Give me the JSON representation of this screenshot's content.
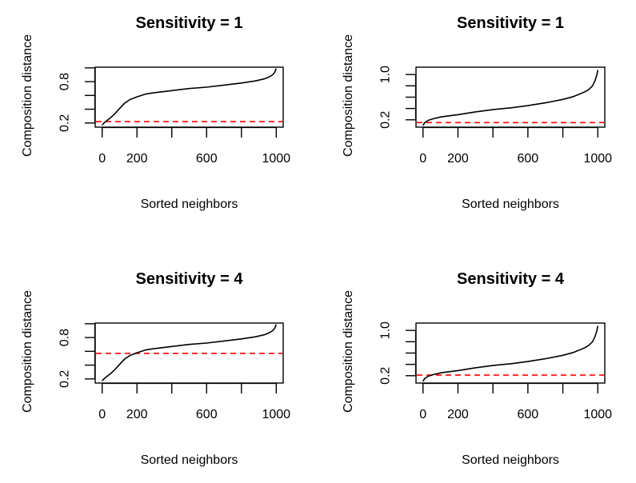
{
  "chart_data": [
    {
      "type": "line",
      "panel": "top-left",
      "title": "Sensitivity =  1",
      "xlabel": "Sorted neighbors",
      "ylabel": "Composition distance",
      "xlim": [
        -40,
        1040
      ],
      "ylim": [
        0.14,
        1.01
      ],
      "xticks": [
        0,
        200,
        400,
        600,
        800,
        1000
      ],
      "xtick_labels": [
        "0",
        "200",
        "",
        "600",
        "",
        "1000"
      ],
      "yticks": [
        0.2,
        0.4,
        0.6,
        0.8,
        1.0
      ],
      "ytick_labels": [
        "0.2",
        "",
        "",
        "0.8",
        ""
      ],
      "grid": false,
      "series": [
        {
          "name": "composition-distance",
          "color": "#000000",
          "x": [
            0,
            10,
            25,
            50,
            75,
            100,
            130,
            160,
            200,
            250,
            300,
            400,
            500,
            600,
            700,
            800,
            880,
            930,
            960,
            980,
            990,
            995,
            1000
          ],
          "y": [
            0.17,
            0.2,
            0.23,
            0.28,
            0.34,
            0.41,
            0.49,
            0.54,
            0.58,
            0.62,
            0.64,
            0.67,
            0.7,
            0.72,
            0.75,
            0.78,
            0.81,
            0.84,
            0.87,
            0.9,
            0.93,
            0.96,
            0.99
          ]
        }
      ],
      "threshold": {
        "value": 0.22,
        "color": "#ff0000",
        "style": "dashed"
      }
    },
    {
      "type": "line",
      "panel": "top-right",
      "title": "Sensitivity =  1",
      "xlabel": "Sorted neighbors",
      "ylabel": "Composition distance",
      "xlim": [
        -40,
        1040
      ],
      "ylim": [
        0.07,
        1.13
      ],
      "xticks": [
        0,
        200,
        400,
        600,
        800,
        1000
      ],
      "xtick_labels": [
        "0",
        "200",
        "",
        "600",
        "",
        "1000"
      ],
      "yticks": [
        0.2,
        0.4,
        0.6,
        0.8,
        1.0
      ],
      "ytick_labels": [
        "0.2",
        "",
        "",
        "",
        "1.0"
      ],
      "grid": false,
      "series": [
        {
          "name": "composition-distance",
          "color": "#000000",
          "x": [
            0,
            10,
            30,
            60,
            100,
            150,
            200,
            300,
            400,
            500,
            600,
            700,
            800,
            860,
            900,
            930,
            950,
            970,
            985,
            995,
            1000
          ],
          "y": [
            0.1,
            0.15,
            0.19,
            0.22,
            0.25,
            0.27,
            0.29,
            0.34,
            0.38,
            0.41,
            0.45,
            0.5,
            0.56,
            0.61,
            0.66,
            0.7,
            0.74,
            0.8,
            0.9,
            1.0,
            1.08
          ]
        }
      ],
      "threshold": {
        "value": 0.15,
        "color": "#ff0000",
        "style": "dashed"
      }
    },
    {
      "type": "line",
      "panel": "bottom-left",
      "title": "Sensitivity =  4",
      "xlabel": "Sorted neighbors",
      "ylabel": "Composition distance",
      "xlim": [
        -40,
        1040
      ],
      "ylim": [
        0.14,
        1.01
      ],
      "xticks": [
        0,
        200,
        400,
        600,
        800,
        1000
      ],
      "xtick_labels": [
        "0",
        "200",
        "",
        "600",
        "",
        "1000"
      ],
      "yticks": [
        0.2,
        0.4,
        0.6,
        0.8,
        1.0
      ],
      "ytick_labels": [
        "0.2",
        "",
        "",
        "0.8",
        ""
      ],
      "grid": false,
      "series": [
        {
          "name": "composition-distance",
          "color": "#000000",
          "x": [
            0,
            10,
            25,
            50,
            75,
            100,
            130,
            160,
            200,
            250,
            300,
            400,
            500,
            600,
            700,
            800,
            880,
            930,
            960,
            980,
            990,
            995,
            1000
          ],
          "y": [
            0.17,
            0.2,
            0.23,
            0.28,
            0.34,
            0.41,
            0.49,
            0.54,
            0.58,
            0.62,
            0.64,
            0.67,
            0.7,
            0.72,
            0.75,
            0.78,
            0.81,
            0.84,
            0.87,
            0.9,
            0.93,
            0.96,
            0.99
          ]
        }
      ],
      "threshold": {
        "value": 0.57,
        "color": "#ff0000",
        "style": "dashed"
      }
    },
    {
      "type": "line",
      "panel": "bottom-right",
      "title": "Sensitivity =  4",
      "xlabel": "Sorted neighbors",
      "ylabel": "Composition distance",
      "xlim": [
        -40,
        1040
      ],
      "ylim": [
        0.07,
        1.13
      ],
      "xticks": [
        0,
        200,
        400,
        600,
        800,
        1000
      ],
      "xtick_labels": [
        "0",
        "200",
        "",
        "600",
        "",
        "1000"
      ],
      "yticks": [
        0.2,
        0.4,
        0.6,
        0.8,
        1.0
      ],
      "ytick_labels": [
        "0.2",
        "",
        "",
        "",
        "1.0"
      ],
      "grid": false,
      "series": [
        {
          "name": "composition-distance",
          "color": "#000000",
          "x": [
            0,
            10,
            30,
            60,
            100,
            150,
            200,
            300,
            400,
            500,
            600,
            700,
            800,
            860,
            900,
            930,
            950,
            970,
            985,
            995,
            1000
          ],
          "y": [
            0.1,
            0.15,
            0.19,
            0.22,
            0.25,
            0.27,
            0.29,
            0.34,
            0.38,
            0.41,
            0.45,
            0.5,
            0.56,
            0.61,
            0.66,
            0.7,
            0.74,
            0.8,
            0.9,
            1.0,
            1.08
          ]
        }
      ],
      "threshold": {
        "value": 0.21,
        "color": "#ff0000",
        "style": "dashed"
      }
    }
  ]
}
